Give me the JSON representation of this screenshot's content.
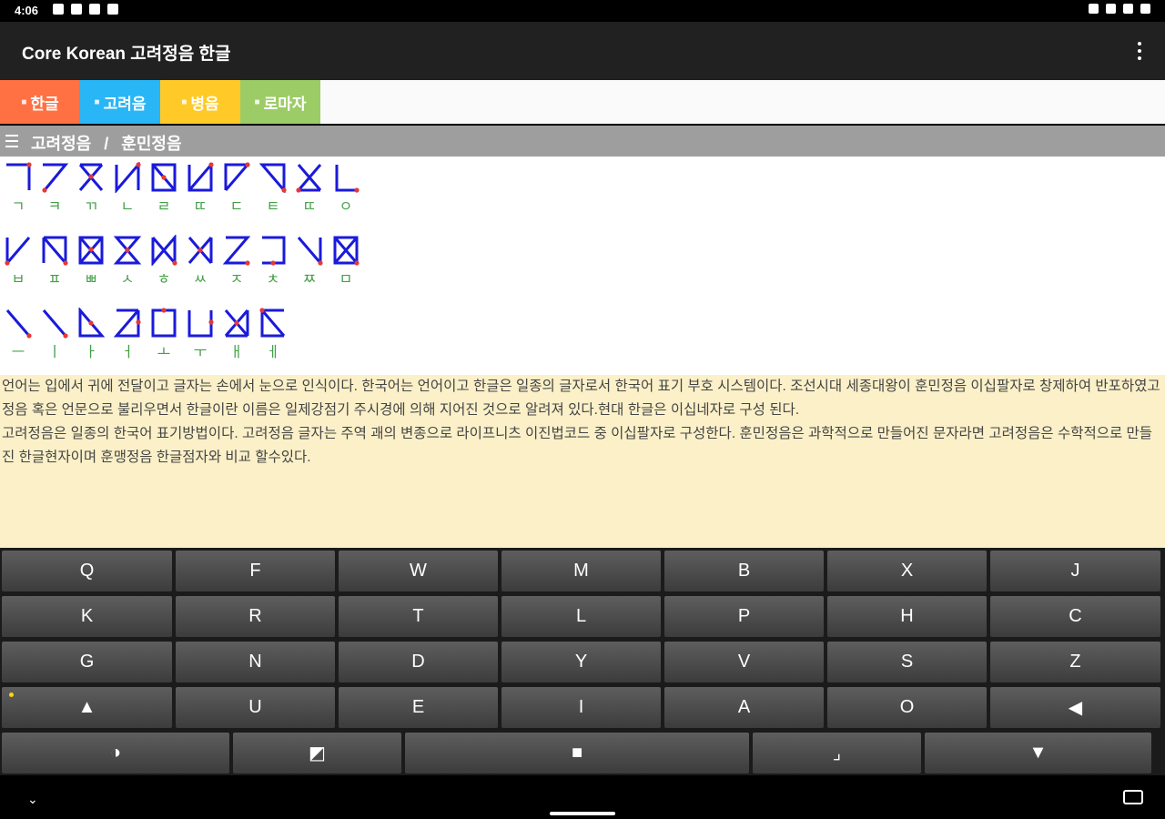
{
  "status": {
    "time": "4:06"
  },
  "app": {
    "title": "Core Korean 고려정음 한글"
  },
  "tabs": [
    {
      "label": "한글",
      "color": "#ff7043"
    },
    {
      "label": "고려음",
      "color": "#29b6f6"
    },
    {
      "label": "병음",
      "color": "#ffca28"
    },
    {
      "label": "로마자",
      "color": "#9ccc65"
    }
  ],
  "breadcrumb": {
    "first": "고려정음",
    "separator": "/",
    "second": "훈민정음"
  },
  "glyph_rows": [
    [
      "ㄱ",
      "ㅋ",
      "ㄲ",
      "ㄴ",
      "ㄹ",
      "ㄸ",
      "ㄷ",
      "ㅌ",
      "ㄸ",
      "ㅇ"
    ],
    [
      "ㅂ",
      "ㅍ",
      "ㅃ",
      "ㅅ",
      "ㅎ",
      "ㅆ",
      "ㅈ",
      "ㅊ",
      "ㅉ",
      "ㅁ"
    ],
    [
      "ㅡ",
      "ㅣ",
      "ㅏ",
      "ㅓ",
      "ㅗ",
      "ㅜ",
      "ㅐ",
      "ㅔ"
    ]
  ],
  "text": {
    "paragraph1": "언어는 입에서 귀에 전달이고 글자는 손에서 눈으로 인식이다. 한국어는 언어이고 한글은 일종의 글자로서 한국어 표기 부호 시스템이다. 조선시대 세종대왕이 훈민정음 이십팔자로 창제하여 반포하였고 정음 혹은 언문으로 불리우면서 한글이란 이름은 일제강점기 주시경에 의해 지어진 것으로 알려져 있다.현대 한글은 이십네자로 구성 된다.",
    "paragraph2": " 고려정음은 일종의 한국어 표기방법이다. 고려정음 글자는 주역 괘의 변종으로 라이프니츠 이진법코드 중 이십팔자로 구성한다. 훈민정음은 과학적으로 만들어진 문자라면 고려정음은 수학적으로 만들진 한글현자이며 훈맹정음 한글점자와 비교 할수있다."
  },
  "keyboard": {
    "row1": [
      "Q",
      "F",
      "W",
      "M",
      "B",
      "X",
      "J"
    ],
    "row2": [
      "K",
      "R",
      "T",
      "L",
      "P",
      "H",
      "C"
    ],
    "row3": [
      "G",
      "N",
      "D",
      "Y",
      "V",
      "S",
      "Z"
    ],
    "row4": [
      "▲",
      "U",
      "E",
      "I",
      "A",
      "O",
      "◀"
    ],
    "row5": [
      "◑",
      "◩",
      "■",
      "⌟",
      "▼"
    ]
  },
  "colors": {
    "glyph_stroke": "#1a1adb",
    "glyph_dot": "#e53935",
    "jamo": "#43a047"
  }
}
